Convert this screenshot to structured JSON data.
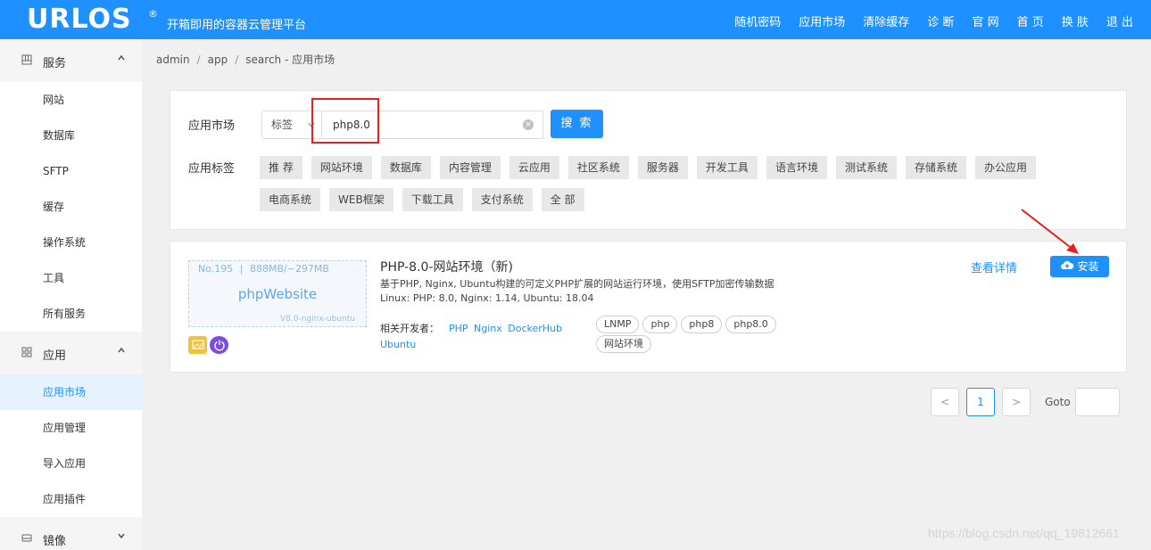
{
  "header": {
    "logo": "URLOS",
    "logo_reg": "®",
    "subtitle": "开箱即用的容器云管理平台",
    "nav": [
      "随机密码",
      "应用市场",
      "清除缓存",
      "诊 断",
      "官 网",
      "首 页",
      "换 肤",
      "退 出"
    ]
  },
  "sidebar": {
    "groups": [
      {
        "icon": "grid-icon",
        "label": "服务",
        "expanded": true,
        "items": [
          "网站",
          "数据库",
          "SFTP",
          "缓存",
          "操作系统",
          "工具",
          "所有服务"
        ]
      },
      {
        "icon": "apps-icon",
        "label": "应用",
        "expanded": true,
        "items": [
          "应用市场",
          "应用管理",
          "导入应用",
          "应用插件"
        ],
        "active": "应用市场"
      },
      {
        "icon": "disk-icon",
        "label": "镜像",
        "expanded": false,
        "items": []
      }
    ]
  },
  "breadcrumb": [
    "admin",
    "app",
    "search"
  ],
  "breadcrumb_suffix": "- 应用市场",
  "search": {
    "label": "应用市场",
    "select_value": "标签",
    "input_value": "php8.0",
    "button": "搜 索"
  },
  "tags": {
    "label": "应用标签",
    "items": [
      "推 荐",
      "网站环境",
      "数据库",
      "内容管理",
      "云应用",
      "社区系统",
      "服务器",
      "开发工具",
      "语言环境",
      "测试系统",
      "存储系统",
      "办公应用",
      "电商系统",
      "WEB框架",
      "下载工具",
      "支付系统",
      "全 部"
    ]
  },
  "app": {
    "no": "No.195",
    "size": "888MB/~297MB",
    "thumb_name": "phpWebsite",
    "thumb_version": "V8.0-nginx-ubuntu",
    "title": "PHP-8.0-网站环境（新)",
    "description": "基于PHP, Nginx, Ubuntu构建的可定义PHP扩展的网站运行环境，使用SFTP加密传输数据",
    "versions": "Linux: PHP: 8.0, Nginx: 1.14, Ubuntu: 18.04",
    "dev_label": "相关开发者：",
    "developers": [
      "PHP",
      "Nginx",
      "DockerHub",
      "Ubuntu"
    ],
    "tags": [
      "LNMP",
      "php",
      "php8",
      "php8.0",
      "网站环境"
    ],
    "detail": "查看详情",
    "install": "安装"
  },
  "pagination": {
    "current": "1",
    "prev": "<",
    "next": ">",
    "goto": "Goto"
  },
  "watermark": "https://blog.csdn.net/qq_19812661"
}
